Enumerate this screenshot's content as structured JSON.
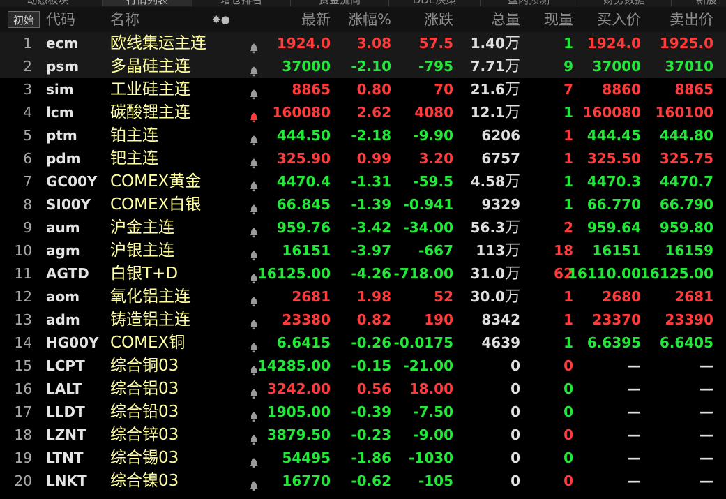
{
  "colors": {
    "up": "#ff3b3b",
    "down": "#22e838",
    "neutral": "#e0e0e0",
    "name": "#ffffa0",
    "alert_bell": "#ff3b3b",
    "bell": "#9a9a9a"
  },
  "tabs": [
    {
      "label": "动态板块",
      "active": false
    },
    {
      "label": "行情列表",
      "active": true
    },
    {
      "label": "增仓排名",
      "active": false
    },
    {
      "label": "资金流向",
      "active": false
    },
    {
      "label": "DDE决策",
      "active": false
    },
    {
      "label": "盘内预测",
      "active": false
    },
    {
      "label": "财务数据",
      "active": false
    },
    {
      "label": "新股",
      "active": false
    }
  ],
  "header": {
    "init_button": "初始",
    "code": "代码",
    "name": "名称",
    "dots": "✸●",
    "price": "最新",
    "pct": "涨幅%",
    "change": "涨跌",
    "volume": "总量",
    "current": "现量",
    "bid": "买入价",
    "ask": "卖出价"
  },
  "rows": [
    {
      "idx": "1",
      "code": "ecm",
      "name": "欧线集运主连",
      "bell": "bell-icon",
      "price": "1924.0",
      "pct": "3.08",
      "change": "57.5",
      "vol": "1.40",
      "vol_unit": "万",
      "cur": "1",
      "bid": "1924.0",
      "ask": "1925.0",
      "color": "red",
      "cur_color": "green",
      "selected": true
    },
    {
      "idx": "2",
      "code": "psm",
      "name": "多晶硅主连",
      "bell": "bell-icon",
      "price": "37000",
      "pct": "-2.10",
      "change": "-795",
      "vol": "7.71",
      "vol_unit": "万",
      "cur": "9",
      "bid": "37000",
      "ask": "37010",
      "color": "green",
      "cur_color": "green",
      "selected": true
    },
    {
      "idx": "3",
      "code": "sim",
      "name": "工业硅主连",
      "bell": "bell-icon",
      "price": "8865",
      "pct": "0.80",
      "change": "70",
      "vol": "21.6",
      "vol_unit": "万",
      "cur": "7",
      "bid": "8860",
      "ask": "8865",
      "color": "red",
      "cur_color": "red",
      "selected": false
    },
    {
      "idx": "4",
      "code": "lcm",
      "name": "碳酸锂主连",
      "bell": "alert-bell-icon",
      "price": "160080",
      "pct": "2.62",
      "change": "4080",
      "vol": "12.1",
      "vol_unit": "万",
      "cur": "1",
      "bid": "160080",
      "ask": "160100",
      "color": "red",
      "cur_color": "green",
      "selected": false
    },
    {
      "idx": "5",
      "code": "ptm",
      "name": "铂主连",
      "bell": "bell-icon",
      "price": "444.50",
      "pct": "-2.18",
      "change": "-9.90",
      "vol": "6206",
      "vol_unit": "",
      "cur": "1",
      "bid": "444.45",
      "ask": "444.80",
      "color": "green",
      "cur_color": "red",
      "selected": false
    },
    {
      "idx": "6",
      "code": "pdm",
      "name": "钯主连",
      "bell": "bell-icon",
      "price": "325.90",
      "pct": "0.99",
      "change": "3.20",
      "vol": "6757",
      "vol_unit": "",
      "cur": "1",
      "bid": "325.50",
      "ask": "325.75",
      "color": "red",
      "cur_color": "red",
      "selected": false
    },
    {
      "idx": "7",
      "code": "GC00Y",
      "name": "COMEX黄金",
      "bell": "bell-icon",
      "price": "4470.4",
      "pct": "-1.31",
      "change": "-59.5",
      "vol": "4.58",
      "vol_unit": "万",
      "cur": "1",
      "bid": "4470.3",
      "ask": "4470.7",
      "color": "green",
      "cur_color": "green",
      "selected": false
    },
    {
      "idx": "8",
      "code": "SI00Y",
      "name": "COMEX白银",
      "bell": "bell-icon",
      "price": "66.845",
      "pct": "-1.39",
      "change": "-0.941",
      "vol": "9329",
      "vol_unit": "",
      "cur": "1",
      "bid": "66.770",
      "ask": "66.790",
      "color": "green",
      "cur_color": "green",
      "selected": false
    },
    {
      "idx": "9",
      "code": "aum",
      "name": "沪金主连",
      "bell": "bell-icon",
      "price": "959.76",
      "pct": "-3.42",
      "change": "-34.00",
      "vol": "56.3",
      "vol_unit": "万",
      "cur": "2",
      "bid": "959.64",
      "ask": "959.80",
      "color": "green",
      "cur_color": "red",
      "selected": false
    },
    {
      "idx": "10",
      "code": "agm",
      "name": "沪银主连",
      "bell": "bell-icon",
      "price": "16151",
      "pct": "-3.97",
      "change": "-667",
      "vol": "113",
      "vol_unit": "万",
      "cur": "18",
      "bid": "16151",
      "ask": "16159",
      "color": "green",
      "cur_color": "red",
      "selected": false
    },
    {
      "idx": "11",
      "code": "AGTD",
      "name": "白银T+D",
      "bell": "bell-icon",
      "price": "16125.00",
      "pct": "-4.26",
      "change": "-718.00",
      "vol": "31.0",
      "vol_unit": "万",
      "cur": "62",
      "bid": "16110.00",
      "ask": "16125.00",
      "color": "green",
      "cur_color": "red",
      "selected": false
    },
    {
      "idx": "12",
      "code": "aom",
      "name": "氧化铝主连",
      "bell": "bell-icon",
      "price": "2681",
      "pct": "1.98",
      "change": "52",
      "vol": "30.0",
      "vol_unit": "万",
      "cur": "1",
      "bid": "2680",
      "ask": "2681",
      "color": "red",
      "cur_color": "red",
      "selected": false
    },
    {
      "idx": "13",
      "code": "adm",
      "name": "铸造铝主连",
      "bell": "bell-icon",
      "price": "23380",
      "pct": "0.82",
      "change": "190",
      "vol": "8342",
      "vol_unit": "",
      "cur": "1",
      "bid": "23370",
      "ask": "23390",
      "color": "red",
      "cur_color": "red",
      "selected": false
    },
    {
      "idx": "14",
      "code": "HG00Y",
      "name": "COMEX铜",
      "bell": "bell-icon",
      "price": "6.6415",
      "pct": "-0.26",
      "change": "-0.0175",
      "vol": "4639",
      "vol_unit": "",
      "cur": "1",
      "bid": "6.6395",
      "ask": "6.6405",
      "color": "green",
      "cur_color": "green",
      "selected": false
    },
    {
      "idx": "15",
      "code": "LCPT",
      "name": "综合铜03",
      "bell": "bell-icon",
      "price": "14285.00",
      "pct": "-0.15",
      "change": "-21.00",
      "vol": "0",
      "vol_unit": "",
      "cur": "0",
      "bid": "—",
      "ask": "—",
      "color": "green",
      "cur_color": "red",
      "selected": false
    },
    {
      "idx": "16",
      "code": "LALT",
      "name": "综合铝03",
      "bell": "bell-icon",
      "price": "3242.00",
      "pct": "0.56",
      "change": "18.00",
      "vol": "0",
      "vol_unit": "",
      "cur": "0",
      "bid": "—",
      "ask": "—",
      "color": "red",
      "cur_color": "green",
      "selected": false
    },
    {
      "idx": "17",
      "code": "LLDT",
      "name": "综合铅03",
      "bell": "bell-icon",
      "price": "1905.00",
      "pct": "-0.39",
      "change": "-7.50",
      "vol": "0",
      "vol_unit": "",
      "cur": "0",
      "bid": "—",
      "ask": "—",
      "color": "green",
      "cur_color": "green",
      "selected": false
    },
    {
      "idx": "18",
      "code": "LZNT",
      "name": "综合锌03",
      "bell": "bell-icon",
      "price": "3879.50",
      "pct": "-0.23",
      "change": "-9.00",
      "vol": "0",
      "vol_unit": "",
      "cur": "0",
      "bid": "—",
      "ask": "—",
      "color": "green",
      "cur_color": "red",
      "selected": false
    },
    {
      "idx": "19",
      "code": "LTNT",
      "name": "综合锡03",
      "bell": "bell-icon",
      "price": "54495",
      "pct": "-1.86",
      "change": "-1030",
      "vol": "0",
      "vol_unit": "",
      "cur": "0",
      "bid": "—",
      "ask": "—",
      "color": "green",
      "cur_color": "green",
      "selected": false
    },
    {
      "idx": "20",
      "code": "LNKT",
      "name": "综合镍03",
      "bell": "bell-icon",
      "price": "16770",
      "pct": "-0.62",
      "change": "-105",
      "vol": "0",
      "vol_unit": "",
      "cur": "0",
      "bid": "—",
      "ask": "—",
      "color": "green",
      "cur_color": "red",
      "selected": false
    }
  ]
}
